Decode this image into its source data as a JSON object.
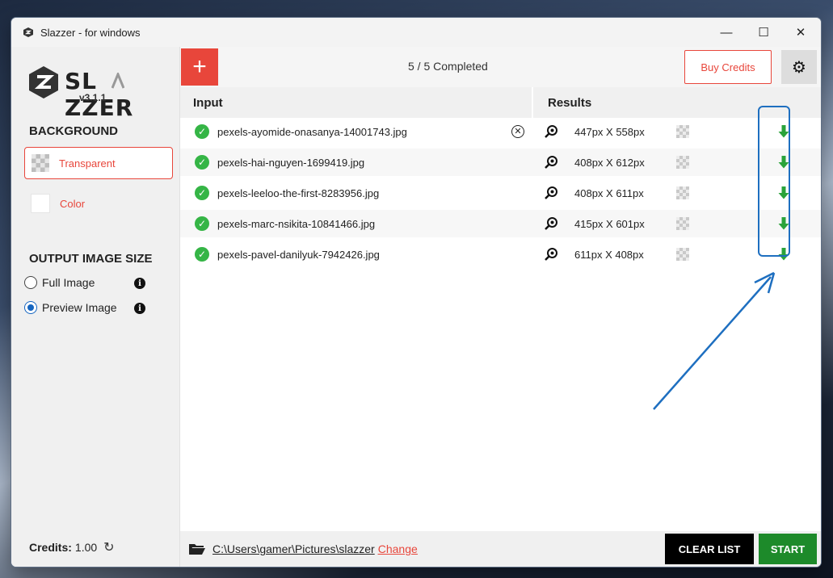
{
  "window": {
    "title": "Slazzer - for windows",
    "minimize": "—",
    "maximize": "☐",
    "close": "✕"
  },
  "sidebar": {
    "logo_text": "SL ZZER",
    "version": "v3.1.1",
    "background_heading": "BACKGROUND",
    "background_options": [
      {
        "label": "Transparent",
        "selected": true
      },
      {
        "label": "Color",
        "selected": false
      }
    ],
    "output_heading": "OUTPUT IMAGE SIZE",
    "output_options": [
      {
        "label": "Full Image",
        "selected": false
      },
      {
        "label": "Preview Image",
        "selected": true
      }
    ],
    "credits_label": "Credits:",
    "credits_value": "1.00"
  },
  "toolbar": {
    "add_label": "+",
    "status": "5 / 5 Completed",
    "buy_credits": "Buy Credits",
    "settings_icon": "gear-icon"
  },
  "columns": {
    "input": "Input",
    "results": "Results"
  },
  "files": [
    {
      "name": "pexels-ayomide-onasanya-14001743.jpg",
      "dims": "447px X 558px",
      "has_remove": true
    },
    {
      "name": "pexels-hai-nguyen-1699419.jpg",
      "dims": "408px X 612px",
      "has_remove": false
    },
    {
      "name": "pexels-leeloo-the-first-8283956.jpg",
      "dims": "408px X 611px",
      "has_remove": false
    },
    {
      "name": "pexels-marc-nsikita-10841466.jpg",
      "dims": "415px X 601px",
      "has_remove": false
    },
    {
      "name": "pexels-pavel-danilyuk-7942426.jpg",
      "dims": "611px X 408px",
      "has_remove": false
    }
  ],
  "footer": {
    "path": "C:\\Users\\gamer\\Pictures\\slazzer",
    "change": "Change",
    "clear_list": "CLEAR LIST",
    "start": "START"
  },
  "colors": {
    "accent": "#e8463b",
    "success": "#35b546",
    "start": "#1d8a2a",
    "annotation": "#1e6fc0"
  }
}
